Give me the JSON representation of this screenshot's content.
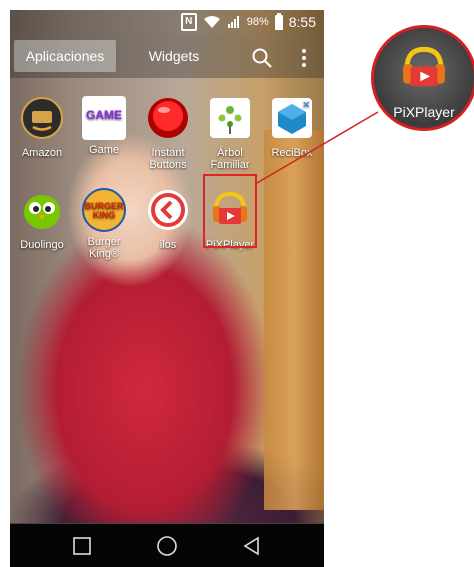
{
  "status": {
    "battery_percent": "98%",
    "time": "8:55"
  },
  "tabs": {
    "apps": "Aplicaciones",
    "widgets": "Widgets"
  },
  "apps": [
    {
      "label": "Amazon"
    },
    {
      "label": "Game"
    },
    {
      "label": "Instant Buttons"
    },
    {
      "label": "Árbol Familiar"
    },
    {
      "label": "ReciBox"
    },
    {
      "label": "Duolingo"
    },
    {
      "label": "Burger King®"
    },
    {
      "label": "ilos"
    },
    {
      "label": "PiXPlayer"
    }
  ],
  "icons": {
    "game_text": "GAME",
    "burger_king_text": "BURGER KING"
  },
  "callout": {
    "label": "PiXPlayer"
  },
  "colors": {
    "highlight": "#e02424"
  }
}
